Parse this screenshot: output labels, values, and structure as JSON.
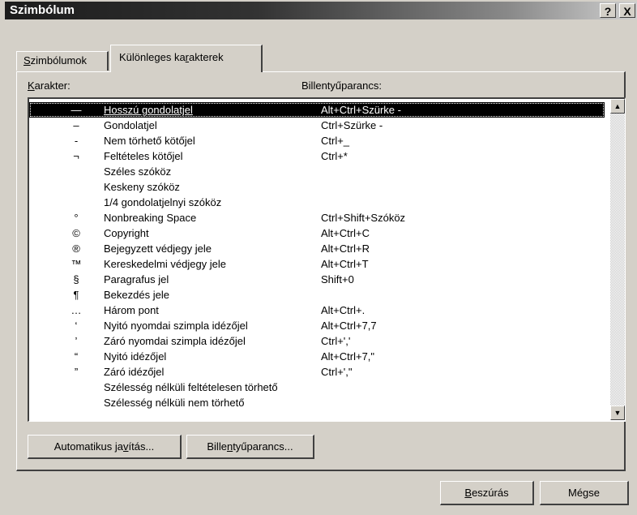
{
  "window": {
    "title": "Szimbólum",
    "help_label": "?",
    "close_label": "X"
  },
  "tabs": [
    {
      "pre": "",
      "key": "S",
      "post": "zimbólumok"
    },
    {
      "pre": "Különleges ka",
      "key": "r",
      "post": "akterek"
    }
  ],
  "columns": {
    "char_pre": "",
    "char_key": "K",
    "char_post": "arakter:",
    "shortcut": "Billentyűparancs:"
  },
  "rows": [
    {
      "symbol": "—",
      "name": "Hosszú gondolatjel",
      "shortcut": "Alt+Ctrl+Szürke -"
    },
    {
      "symbol": "–",
      "name": "Gondolatjel",
      "shortcut": "Ctrl+Szürke -"
    },
    {
      "symbol": "-",
      "name": "Nem törhető kötőjel",
      "shortcut": "Ctrl+_"
    },
    {
      "symbol": "¬",
      "name": "Feltételes kötőjel",
      "shortcut": "Ctrl+*"
    },
    {
      "symbol": "",
      "name": "Széles szóköz",
      "shortcut": ""
    },
    {
      "symbol": "",
      "name": "Keskeny szóköz",
      "shortcut": ""
    },
    {
      "symbol": "",
      "name": "1/4 gondolatjelnyi szóköz",
      "shortcut": ""
    },
    {
      "symbol": "°",
      "name": "Nonbreaking Space",
      "shortcut": "Ctrl+Shift+Szóköz"
    },
    {
      "symbol": "©",
      "name": "Copyright",
      "shortcut": "Alt+Ctrl+C"
    },
    {
      "symbol": "®",
      "name": "Bejegyzett védjegy jele",
      "shortcut": "Alt+Ctrl+R"
    },
    {
      "symbol": "™",
      "name": "Kereskedelmi védjegy jele",
      "shortcut": "Alt+Ctrl+T"
    },
    {
      "symbol": "§",
      "name": "Paragrafus jel",
      "shortcut": "Shift+0"
    },
    {
      "symbol": "¶",
      "name": "Bekezdés jele",
      "shortcut": ""
    },
    {
      "symbol": "…",
      "name": "Három pont",
      "shortcut": "Alt+Ctrl+."
    },
    {
      "symbol": "‘",
      "name": "Nyitó nyomdai szimpla idézőjel",
      "shortcut": "Alt+Ctrl+7,7"
    },
    {
      "symbol": "’",
      "name": "Záró nyomdai szimpla idézőjel",
      "shortcut": "Ctrl+','"
    },
    {
      "symbol": "“",
      "name": "Nyitó idézőjel",
      "shortcut": "Alt+Ctrl+7,\""
    },
    {
      "symbol": "”",
      "name": "Záró idézőjel",
      "shortcut": "Ctrl+',\""
    },
    {
      "symbol": "",
      "name": "Szélesség nélküli feltételesen törhető",
      "shortcut": ""
    },
    {
      "symbol": "",
      "name": "Szélesség nélküli nem törhető",
      "shortcut": ""
    }
  ],
  "scrollbar": {
    "up": "▲",
    "down": "▼"
  },
  "buttons": {
    "autocorrect": {
      "pre": "Automatikus ja",
      "key": "v",
      "post": "ítás..."
    },
    "shortcut": {
      "pre": "Bille",
      "key": "n",
      "post": "tyűparancs..."
    },
    "insert": {
      "pre": "",
      "key": "B",
      "post": "eszúrás"
    },
    "cancel": "Mégse"
  }
}
